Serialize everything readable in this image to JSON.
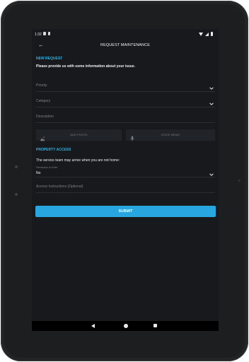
{
  "status_bar": {
    "time": "1:32"
  },
  "toolbar": {
    "back_icon": "arrow-back-icon",
    "title": "REQUEST MAINTENANCE"
  },
  "new_request": {
    "section_title": "NEW REQUEST",
    "intro": "Please provide us with some information about your issue.",
    "priority": {
      "placeholder": "Priority"
    },
    "category": {
      "placeholder": "Category"
    },
    "description": {
      "placeholder": "Description"
    },
    "add_photo": {
      "label": "ADD PHOTO",
      "icon": "image-icon"
    },
    "voice_memo": {
      "label": "VOICE MEMO",
      "icon": "microphone-icon"
    }
  },
  "property_access": {
    "section_title": "PROPERTY ACCESS",
    "note": "The service team may arrive when you are not home:",
    "permission": {
      "label": "Permission to Enter",
      "value": "No"
    },
    "access_instructions": {
      "placeholder": "Access Instructions (Optional)"
    }
  },
  "submit": {
    "label": "SUBMIT"
  },
  "colors": {
    "accent": "#27a6e0",
    "background": "#17191c",
    "text": "#f0f1f2"
  }
}
